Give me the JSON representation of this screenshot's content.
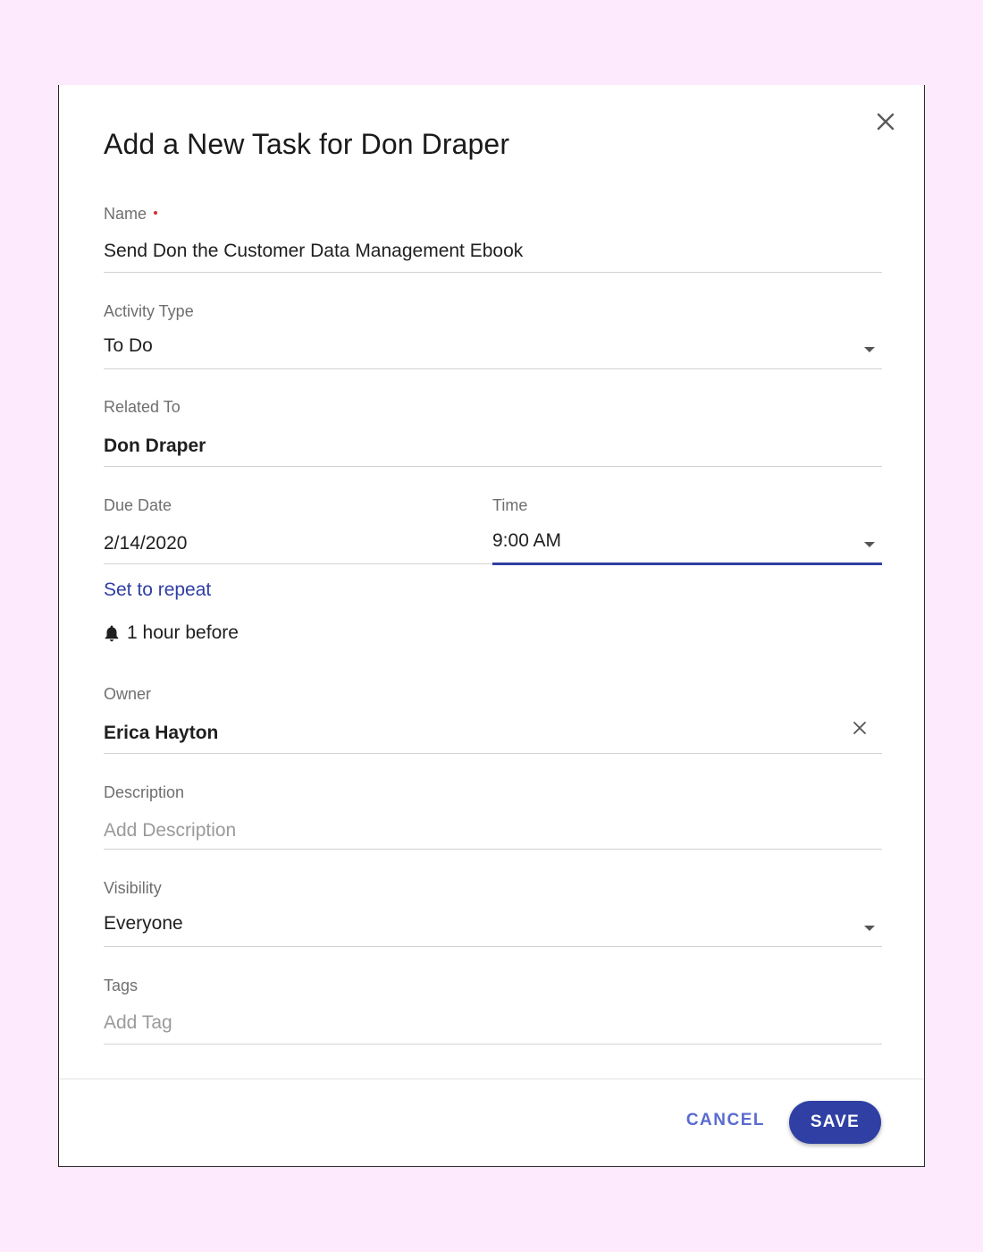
{
  "dialog": {
    "title": "Add a New Task for Don Draper"
  },
  "fields": {
    "name": {
      "label": "Name",
      "value": "Send Don the Customer Data Management Ebook",
      "required": true
    },
    "activity_type": {
      "label": "Activity Type",
      "value": "To Do"
    },
    "related_to": {
      "label": "Related To",
      "value": "Don Draper"
    },
    "due_date": {
      "label": "Due Date",
      "value": "2/14/2020"
    },
    "time": {
      "label": "Time",
      "value": "9:00 AM"
    },
    "owner": {
      "label": "Owner",
      "value": "Erica Hayton"
    },
    "description": {
      "label": "Description",
      "placeholder": "Add Description"
    },
    "visibility": {
      "label": "Visibility",
      "value": "Everyone"
    },
    "tags": {
      "label": "Tags",
      "placeholder": "Add Tag"
    }
  },
  "repeat_link": "Set to repeat",
  "reminder": {
    "icon": "bell-icon",
    "text": "1 hour before"
  },
  "footer": {
    "cancel_label": "CANCEL",
    "save_label": "SAVE"
  },
  "colors": {
    "accent": "#2f3fa3",
    "background": "#fdeafc",
    "required": "#d32f2f"
  }
}
